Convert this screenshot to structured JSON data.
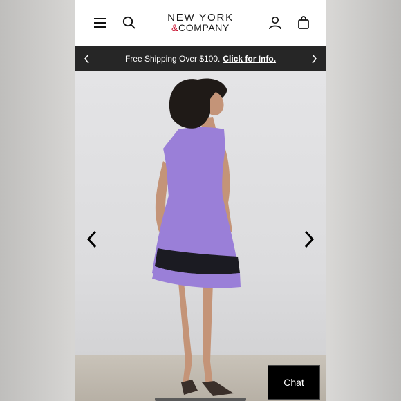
{
  "header": {
    "logo_line1": "NEW YORK",
    "logo_amp": "&",
    "logo_line2": "COMPANY",
    "icons": [
      "menu-icon",
      "search-icon",
      "account-icon",
      "bag-icon"
    ]
  },
  "promo_banner": {
    "text": "Free Shipping Over $100.",
    "link_text": "Click for Info."
  },
  "gallery": {
    "product_colors": {
      "dress": "#9a7fd8",
      "stripe": "#1b1b22"
    }
  },
  "chat": {
    "label": "Chat"
  },
  "colors": {
    "banner_bg": "#262626",
    "brand_accent": "#c8102e"
  }
}
